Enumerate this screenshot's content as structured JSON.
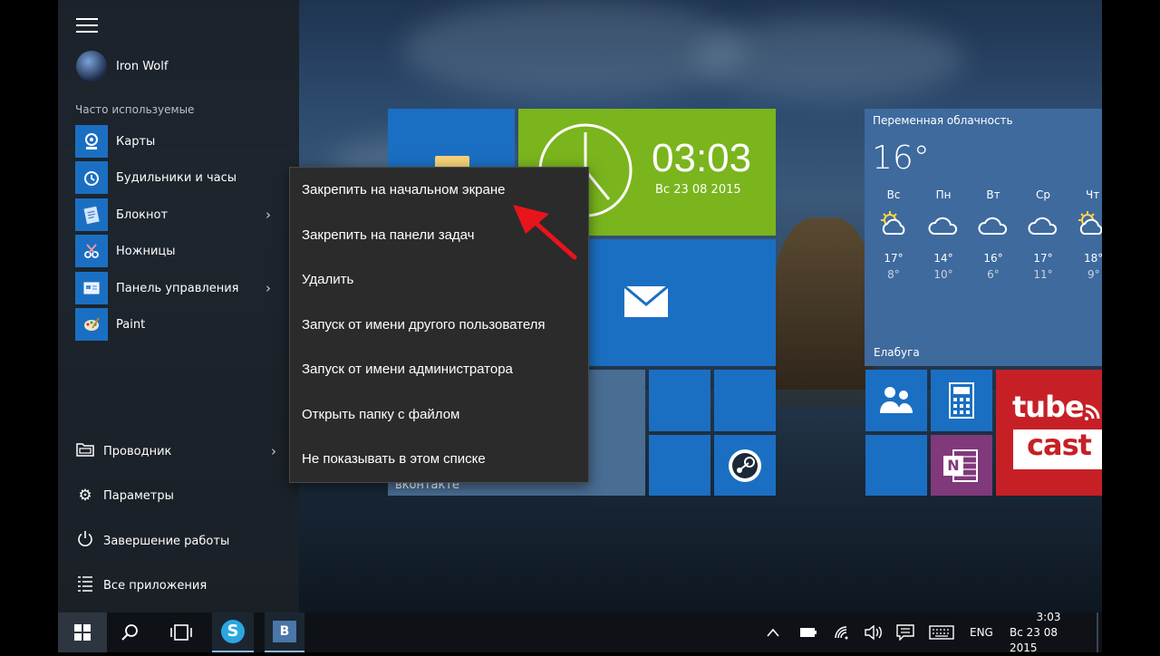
{
  "user": {
    "name": "Iron Wolf"
  },
  "frequent_header": "Часто используемые",
  "apps": [
    {
      "label": "Карты",
      "icon": "maps-icon",
      "has_submenu": false
    },
    {
      "label": "Будильники и часы",
      "icon": "alarm-clock-icon",
      "has_submenu": false
    },
    {
      "label": "Блокнот",
      "icon": "notepad-icon",
      "has_submenu": true
    },
    {
      "label": "Ножницы",
      "icon": "scissors-icon",
      "has_submenu": false
    },
    {
      "label": "Панель управления",
      "icon": "control-panel-icon",
      "has_submenu": true
    },
    {
      "label": "Paint",
      "icon": "paint-icon",
      "has_submenu": false
    }
  ],
  "bottom": {
    "explorer": "Проводник",
    "settings": "Параметры",
    "shutdown": "Завершение работы",
    "all_apps": "Все приложения"
  },
  "context_menu": [
    "Закрепить на начальном экране",
    "Закрепить на панели задач",
    "Удалить",
    "Запуск от имени другого пользователя",
    "Запуск от имени администратора",
    "Открыть папку с файлом",
    "Не показывать в этом списке"
  ],
  "clock_tile": {
    "time": "03:03",
    "date": "Вс 23 08 2015"
  },
  "vk_tile_label": "вконтакте",
  "weather": {
    "condition": "Переменная облачность",
    "temp": "16°",
    "city": "Елабуга",
    "days": [
      {
        "day": "Вс",
        "hi": "17°",
        "lo": "8°",
        "icon": "partly-sunny-icon"
      },
      {
        "day": "Пн",
        "hi": "14°",
        "lo": "10°",
        "icon": "cloud-icon"
      },
      {
        "day": "Вт",
        "hi": "16°",
        "lo": "6°",
        "icon": "cloud-icon"
      },
      {
        "day": "Ср",
        "hi": "17°",
        "lo": "11°",
        "icon": "cloud-icon"
      },
      {
        "day": "Чт",
        "hi": "18°",
        "lo": "9°",
        "icon": "partly-sunny-icon"
      }
    ]
  },
  "tubecast": {
    "line1": "tube",
    "line2": "cast"
  },
  "onenote_letter": "N",
  "taskbar": {
    "vk_letter": "B",
    "lang": "ENG",
    "time": "3:03",
    "date": "Вс 23 08 2015"
  },
  "colors": {
    "accent": "#1b6fc2",
    "clock_tile": "#7ab51d",
    "onenote": "#80397b",
    "tubecast": "#c62026",
    "arrow": "#e8141c"
  }
}
